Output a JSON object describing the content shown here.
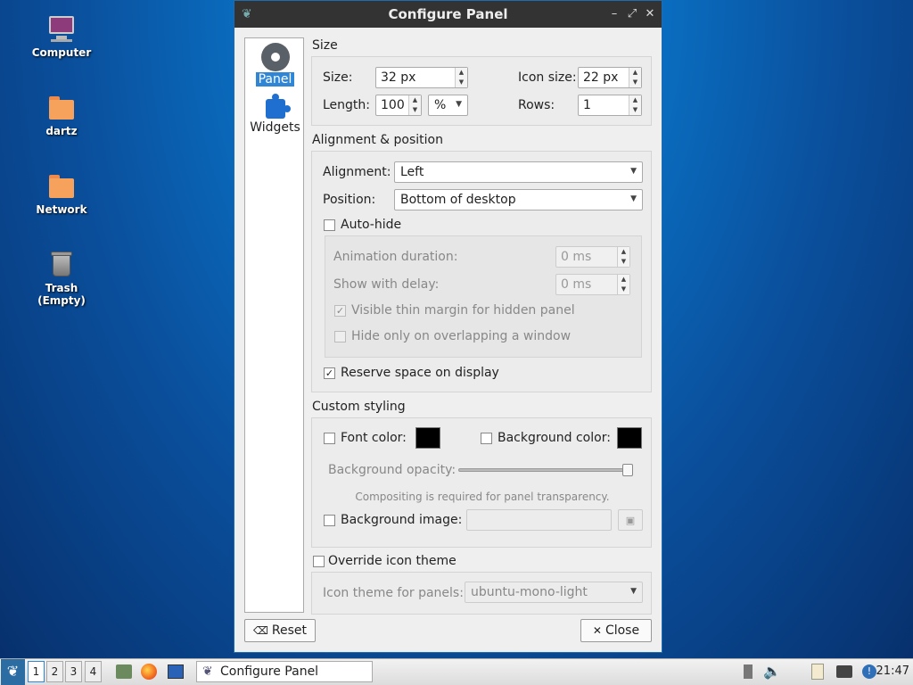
{
  "desktop": {
    "icons": [
      {
        "label": "Computer"
      },
      {
        "label": "dartz"
      },
      {
        "label": "Network"
      },
      {
        "label": "Trash (Empty)"
      }
    ]
  },
  "window": {
    "title": "Configure Panel",
    "sidebar": [
      {
        "label": "Panel",
        "selected": true
      },
      {
        "label": "Widgets"
      }
    ],
    "size": {
      "title": "Size",
      "size_label": "Size:",
      "size_value": "32 px",
      "icon_size_label": "Icon size:",
      "icon_size_value": "22 px",
      "length_label": "Length:",
      "length_value": "100",
      "length_unit": "%",
      "rows_label": "Rows:",
      "rows_value": "1"
    },
    "alignment": {
      "title": "Alignment & position",
      "alignment_label": "Alignment:",
      "alignment_value": "Left",
      "position_label": "Position:",
      "position_value": "Bottom of desktop",
      "autohide_label": "Auto-hide",
      "autohide_checked": false,
      "animation_label": "Animation duration:",
      "animation_value": "0 ms",
      "delay_label": "Show with delay:",
      "delay_value": "0 ms",
      "thin_margin_label": "Visible thin margin for hidden panel",
      "thin_margin_checked": true,
      "overlap_label": "Hide only on overlapping a window",
      "overlap_checked": false,
      "reserve_label": "Reserve space on display",
      "reserve_checked": true
    },
    "custom": {
      "title": "Custom styling",
      "font_color_label": "Font color:",
      "font_color": "#000000",
      "bg_color_label": "Background color:",
      "bg_color": "#000000",
      "opacity_label": "Background opacity:",
      "opacity_percent": 100,
      "compositing_note": "Compositing is required for panel transparency.",
      "bg_image_label": "Background image:",
      "bg_image_value": ""
    },
    "icon_theme": {
      "override_label": "Override icon theme",
      "theme_label": "Icon theme for panels:",
      "theme_value": "ubuntu-mono-light"
    },
    "buttons": {
      "reset": "Reset",
      "close": "Close"
    }
  },
  "taskbar": {
    "workspaces": [
      "1",
      "2",
      "3",
      "4"
    ],
    "active_workspace": "1",
    "task_label": "Configure Panel",
    "clock": "21:47"
  }
}
